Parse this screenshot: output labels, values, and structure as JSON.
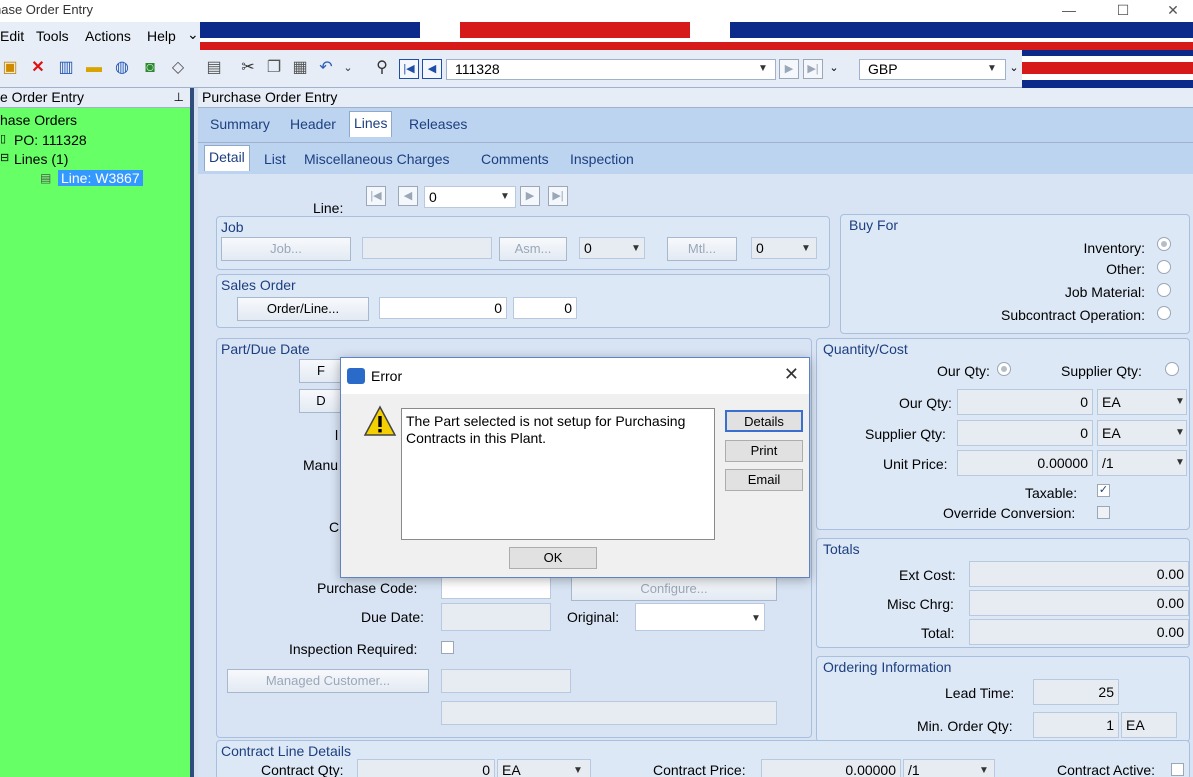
{
  "window": {
    "title": "hase Order Entry",
    "minimize": "—",
    "maximize": "☐",
    "close": "✕"
  },
  "menu": {
    "edit": "Edit",
    "tools": "Tools",
    "actions": "Actions",
    "help": "Help"
  },
  "toolbar": {
    "po_number": "111328",
    "currency": "GBP"
  },
  "left_pane": {
    "header": "e Order Entry",
    "tree": {
      "root": "hase Orders",
      "po": "PO: 111328",
      "lines": "Lines (1)",
      "line": "Line: W3867"
    }
  },
  "main": {
    "header": "Purchase Order Entry",
    "tabs": [
      "Summary",
      "Header",
      "Lines",
      "Releases"
    ],
    "subtabs": [
      "Detail",
      "List",
      "Miscellaneous Charges",
      "Comments",
      "Inspection"
    ]
  },
  "line_nav": {
    "label": "Line:",
    "value": "0"
  },
  "job": {
    "title": "Job",
    "job_btn": "Job...",
    "asm_btn": "Asm...",
    "asm_val": "0",
    "mtl_btn": "Mtl...",
    "mtl_val": "0"
  },
  "sales_order": {
    "title": "Sales Order",
    "btn": "Order/Line...",
    "order": "0",
    "line": "0"
  },
  "buy_for": {
    "title": "Buy For",
    "options": [
      "Inventory:",
      "Other:",
      "Job Material:",
      "Subcontract Operation:"
    ]
  },
  "part_due": {
    "title": "Part/Due Date",
    "btn1_label": "F",
    "btn2_label": "D",
    "lbl1": "l",
    "manu_label": "Manu",
    "lbl2": "C",
    "purchase_code_label": "Purchase Code:",
    "configure_btn": "Configure...",
    "due_date_label": "Due Date:",
    "original_label": "Original:",
    "inspection_label": "Inspection Required:",
    "managed_btn": "Managed Customer..."
  },
  "qty_cost": {
    "title": "Quantity/Cost",
    "our_qty_radio": "Our Qty:",
    "supplier_qty_radio": "Supplier Qty:",
    "our_qty_label": "Our Qty:",
    "our_qty": "0",
    "our_uom": "EA",
    "supplier_qty_label": "Supplier Qty:",
    "supplier_qty": "0",
    "supplier_uom": "EA",
    "unit_price_label": "Unit Price:",
    "unit_price": "0.00000",
    "price_per": "/1",
    "taxable_label": "Taxable:",
    "override_label": "Override Conversion:"
  },
  "totals": {
    "title": "Totals",
    "ext_cost_label": "Ext Cost:",
    "ext_cost": "0.00",
    "misc_label": "Misc Chrg:",
    "misc": "0.00",
    "total_label": "Total:",
    "total": "0.00"
  },
  "ordering": {
    "title": "Ordering Information",
    "lead_label": "Lead Time:",
    "lead": "25",
    "min_label": "Min. Order Qty:",
    "min": "1",
    "min_uom": "EA"
  },
  "contract": {
    "title": "Contract Line Details",
    "qty_label": "Contract Qty:",
    "qty": "0",
    "uom": "EA",
    "price_label": "Contract Price:",
    "price": "0.00000",
    "per": "/1",
    "active_label": "Contract Active:"
  },
  "dialog": {
    "title": "Error",
    "message": "The Part selected is not setup for Purchasing Contracts in this Plant.",
    "details": "Details",
    "print": "Print",
    "email": "Email",
    "ok": "OK"
  }
}
